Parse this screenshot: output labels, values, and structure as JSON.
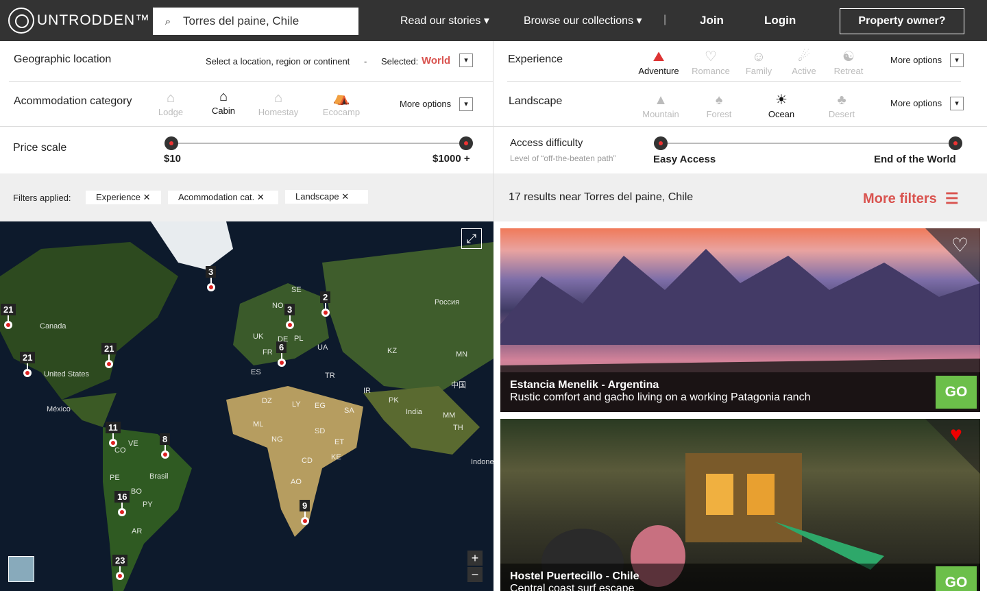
{
  "header": {
    "brand": "UNTRODDEN™",
    "search_icon": "search-icon",
    "search_value": "Torres del paine, Chile",
    "nav_stories": "Read our stories ▾",
    "nav_collections": "Browse our collections ▾",
    "divider": "|",
    "join": "Join",
    "login": "Login",
    "owner": "Property owner?"
  },
  "geo": {
    "label": "Geographic location",
    "hint": "Select a location, region or continent",
    "dash": "-",
    "selected_label": "Selected:",
    "selected_value": "World"
  },
  "experience": {
    "label": "Experience",
    "options": [
      "Adventure",
      "Romance",
      "Family",
      "Active",
      "Retreat"
    ],
    "active": "Adventure",
    "more": "More options"
  },
  "accommodation": {
    "label": "Acommodation category",
    "options": [
      "Lodge",
      "Cabin",
      "Homestay",
      "Ecocamp"
    ],
    "active": "Cabin",
    "more": "More options"
  },
  "landscape": {
    "label": "Landscape",
    "options": [
      "Mountain",
      "Forest",
      "Ocean",
      "Desert"
    ],
    "active": "Ocean",
    "more": "More options"
  },
  "price": {
    "label": "Price scale",
    "min": "$10",
    "max": "$1000 +",
    "range_fraction": [
      0,
      1
    ]
  },
  "difficulty": {
    "label": "Access difficulty",
    "sub": "Level of “off-the-beaten path”",
    "min": "Easy Access",
    "max": "End of the World",
    "range_fraction": [
      0,
      1
    ]
  },
  "filters": {
    "label": "Filters applied:",
    "chips": [
      "Experience ✕",
      "Acommodation cat. ✕",
      "Landscape ✕"
    ]
  },
  "results": {
    "text": "17 results near Torres del paine, Chile",
    "more_filters": "More filters"
  },
  "map": {
    "labels": [
      "Canada",
      "United States",
      "México",
      "Brasil",
      "Россия",
      "India",
      "UK",
      "FR",
      "ES",
      "DE",
      "PL",
      "UA",
      "SE",
      "NO",
      "TR",
      "IR",
      "KZ",
      "MN",
      "PK",
      "DZ",
      "LY",
      "EG",
      "SA",
      "ML",
      "NG",
      "SD",
      "ET",
      "CD",
      "KE",
      "AO",
      "VE",
      "CO",
      "PE",
      "BO",
      "PY",
      "AR",
      "中国",
      "TH",
      "MM",
      "Indone"
    ],
    "pins": [
      "21",
      "21",
      "21",
      "3",
      "3",
      "2",
      "6",
      "11",
      "8",
      "16",
      "23",
      "9"
    ],
    "zoom_in": "+",
    "zoom_out": "−"
  },
  "cards": [
    {
      "title": "Estancia Menelik - Argentina",
      "subtitle": "Rustic comfort and gacho living on a working Patagonia ranch",
      "go": "GO",
      "favorite": false
    },
    {
      "title": "Hostel Puertecillo - Chile",
      "subtitle": "Central coast surf escape",
      "go": "GO",
      "favorite": true
    }
  ],
  "colors": {
    "accent": "#d9534f",
    "go": "#6cbf4a",
    "topbar": "#333333"
  }
}
